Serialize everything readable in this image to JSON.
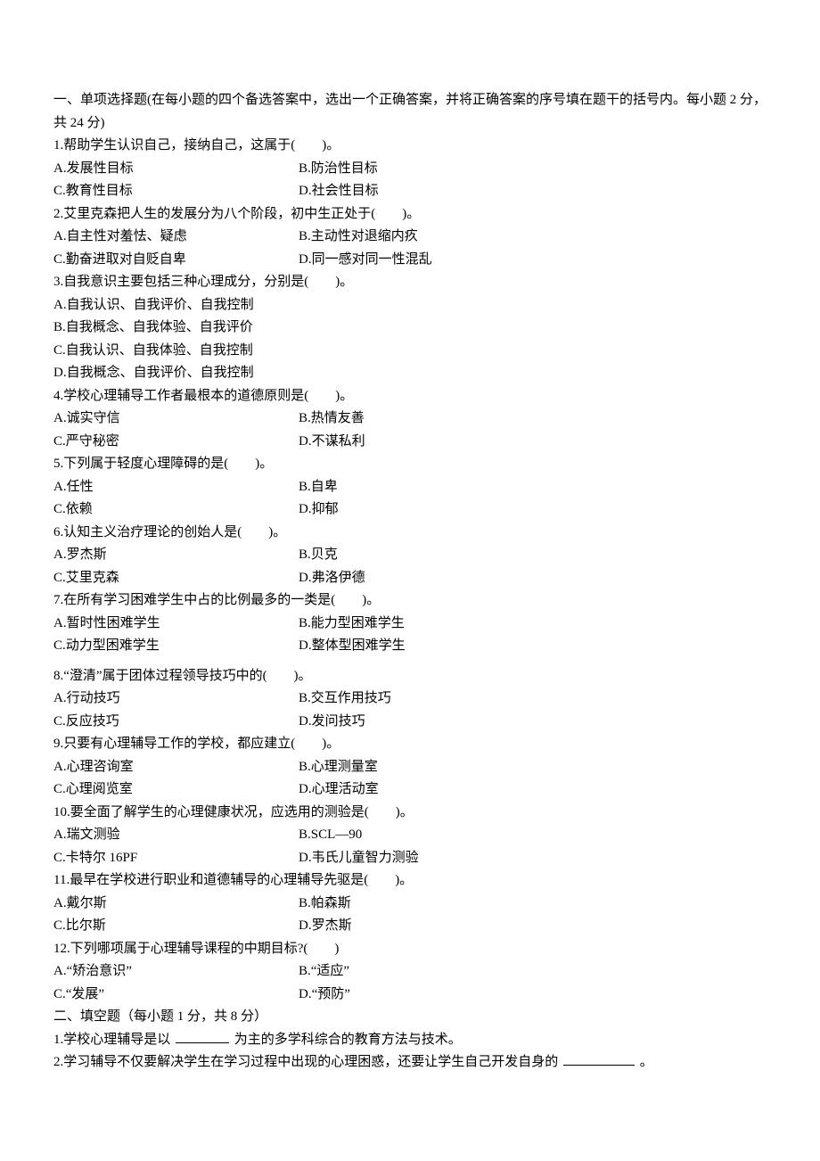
{
  "section1": {
    "header_line1": "一、单项选择题(在每小题的四个备选答案中，选出一个正确答案，并将正确答案的序号填在题干的括号内。每小题 2 分，",
    "header_line2": "共 24 分)",
    "q1": {
      "stem": "1.帮助学生认识自己，接纳自己，这属于(　　)。",
      "a": "A.发展性目标",
      "b": "B.防治性目标",
      "c": "C.教育性目标",
      "d": "D.社会性目标"
    },
    "q2": {
      "stem": "2.艾里克森把人生的发展分为八个阶段，初中生正处于(　　)。",
      "a": "A.自主性对羞怯、疑虑",
      "b": "B.主动性对退缩内疚",
      "c": "C.勤奋进取对自贬自卑",
      "d": "D.同一感对同一性混乱"
    },
    "q3": {
      "stem": "3.自我意识主要包括三种心理成分，分别是(　　)。",
      "a": "A.自我认识、自我评价、自我控制",
      "b": "B.自我概念、自我体验、自我评价",
      "c": "C.自我认识、自我体验、自我控制",
      "d": "D.自我概念、自我评价、自我控制"
    },
    "q4": {
      "stem": "4.学校心理辅导工作者最根本的道德原则是(　　)。",
      "a": "A.诚实守信",
      "b": "B.热情友善",
      "c": "C.严守秘密",
      "d": "D.不谋私利"
    },
    "q5": {
      "stem": "5.下列属于轻度心理障碍的是(　　)。",
      "a": "A.任性",
      "b": "B.自卑",
      "c": "C.依赖",
      "d": "D.抑郁"
    },
    "q6": {
      "stem": "6.认知主义治疗理论的创始人是(　　)。",
      "a": "A.罗杰斯",
      "b": "B.贝克",
      "c": "C.艾里克森",
      "d": "D.弗洛伊德"
    },
    "q7": {
      "stem": "7.在所有学习困难学生中占的比例最多的一类是(　　)。",
      "a": "A.暂时性困难学生",
      "b": "B.能力型困难学生",
      "c": "C.动力型困难学生",
      "d": "D.整体型困难学生"
    },
    "q8": {
      "stem": "8.“澄清”属于团体过程领导技巧中的(　　)。",
      "a": "A.行动技巧",
      "b": "B.交互作用技巧",
      "c": "C.反应技巧",
      "d": "D.发问技巧"
    },
    "q9": {
      "stem": "9.只要有心理辅导工作的学校，都应建立(　　)。",
      "a": "A.心理咨询室",
      "b": "B.心理测量室",
      "c": "C.心理阅览室",
      "d": "D.心理活动室"
    },
    "q10": {
      "stem": "10.要全面了解学生的心理健康状况，应选用的测验是(　　)。",
      "a": "A.瑞文测验",
      "b": "B.SCL—90",
      "c": "C.卡特尔 16PF",
      "d": "D.韦氏儿童智力测验"
    },
    "q11": {
      "stem": "11.最早在学校进行职业和道德辅导的心理辅导先驱是(　　)。",
      "a": "A.戴尔斯",
      "b": "B.帕森斯",
      "c": "C.比尔斯",
      "d": "D.罗杰斯"
    },
    "q12": {
      "stem": "12.下列哪项属于心理辅导课程的中期目标?(　　)",
      "a": "A.“矫治意识”",
      "b": "B.“适应”",
      "c": "C.“发展”",
      "d": "D.“预防”"
    }
  },
  "section2": {
    "header": "二、填空题（每小题 1 分，共 8 分）",
    "q1_pre": "1.学校心理辅导是以",
    "q1_post": "为主的多学科综合的教育方法与技术。",
    "q2_pre": "2.学习辅导不仅要解决学生在学习过程中出现的心理困惑，还要让学生自己开发自身的",
    "q2_post": "。"
  }
}
